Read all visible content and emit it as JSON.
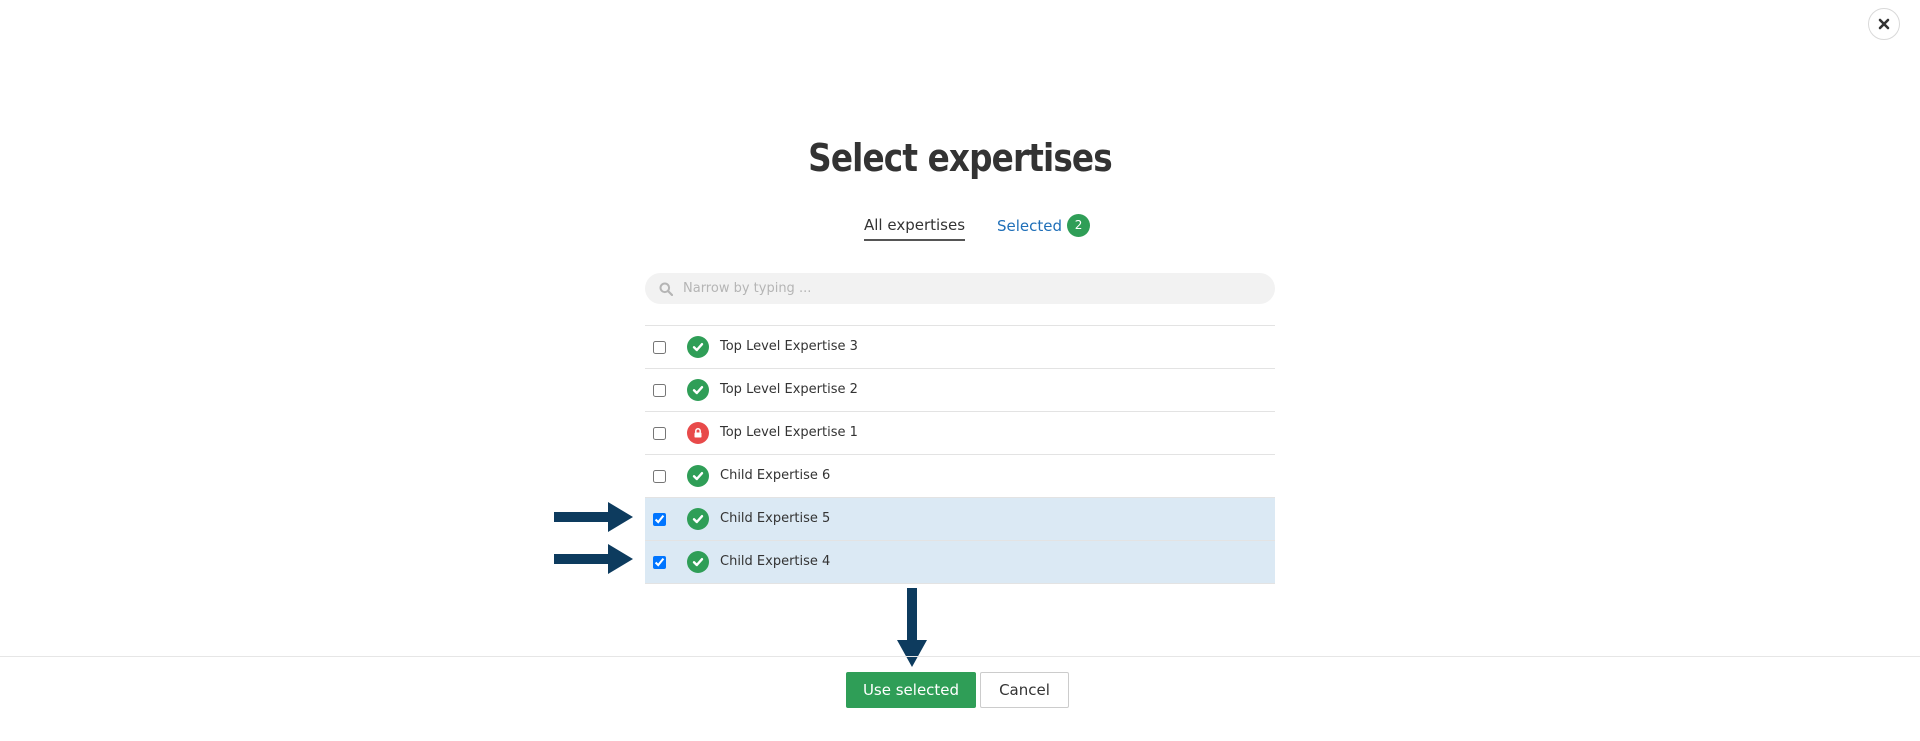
{
  "dialog": {
    "title": "Select expertises",
    "close_icon": "close-icon"
  },
  "tabs": {
    "all_label": "All expertises",
    "selected_label": "Selected",
    "selected_count": "2"
  },
  "search": {
    "placeholder": "Narrow by typing ...",
    "icon": "search-icon"
  },
  "items": [
    {
      "label": "Top Level Expertise 3",
      "checked": false,
      "status": "check-icon"
    },
    {
      "label": "Top Level Expertise 2",
      "checked": false,
      "status": "check-icon"
    },
    {
      "label": "Top Level Expertise 1",
      "checked": false,
      "status": "lock-icon"
    },
    {
      "label": "Child Expertise 6",
      "checked": false,
      "status": "check-icon"
    },
    {
      "label": "Child Expertise 5",
      "checked": true,
      "status": "check-icon"
    },
    {
      "label": "Child Expertise 4",
      "checked": true,
      "status": "check-icon"
    }
  ],
  "footer": {
    "use_selected_label": "Use selected",
    "cancel_label": "Cancel"
  },
  "colors": {
    "accent_green": "#2f9e57",
    "selected_row": "#dbe9f4",
    "tab_link": "#1f6fb8",
    "lock_red": "#e84a4a",
    "annotation_arrow": "#0d3b5e"
  }
}
